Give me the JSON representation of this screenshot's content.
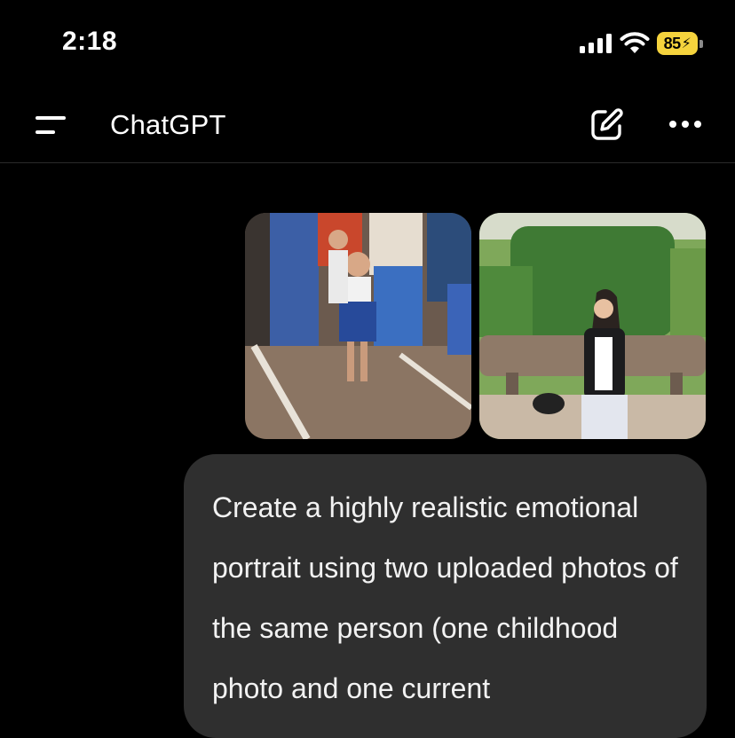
{
  "status_bar": {
    "time": "2:18",
    "battery_percent": "85",
    "icons": [
      "signal-icon",
      "wifi-icon",
      "battery-charging-icon"
    ],
    "battery_color": "#f5d33d"
  },
  "header": {
    "title": "ChatGPT",
    "icons": [
      "menu-icon",
      "new-chat-icon",
      "more-icon"
    ]
  },
  "conversation": {
    "attachments": [
      {
        "kind": "image",
        "subject": "childhood-photo"
      },
      {
        "kind": "image",
        "subject": "current-photo"
      }
    ],
    "user_message": {
      "text": "Create a highly realistic emotional portrait using two uploaded photos of the same person (one childhood photo and one current"
    }
  },
  "colors": {
    "background": "#000000",
    "bubble": "#2f2f2f",
    "text": "#ffffff"
  }
}
